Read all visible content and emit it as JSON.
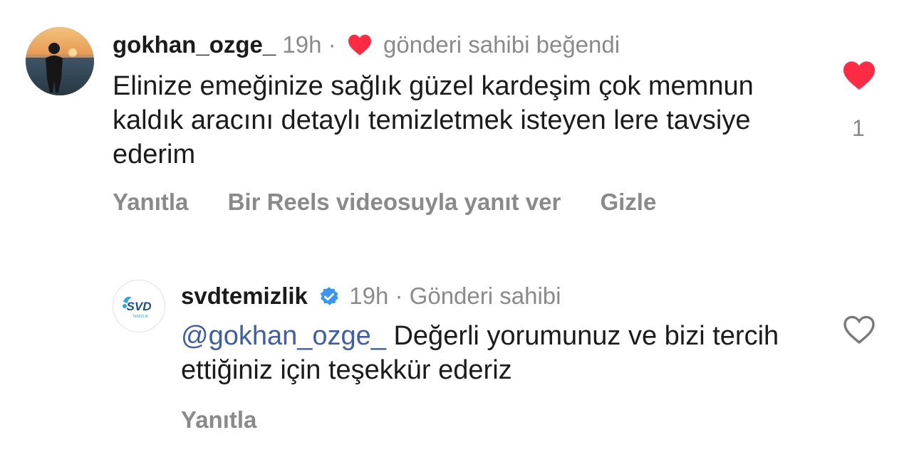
{
  "comment": {
    "username": "gokhan_ozge_",
    "time": "19h",
    "separator": "·",
    "liked_by_author_label": "gönderi sahibi beğendi",
    "text": "Elinize emeğinize sağlık güzel kardeşim çok memnun kaldık aracını detaylı temizletmek isteyen lere tavsiye ederim",
    "like_count": "1",
    "liked": true,
    "actions": {
      "reply": "Yanıtla",
      "reels_reply": "Bir Reels videosuyla yanıt ver",
      "hide": "Gizle"
    }
  },
  "reply": {
    "username": "svdtemizlik",
    "time": "19h",
    "separator": "·",
    "author_label": "Gönderi sahibi",
    "mention": "@gokhan_ozge_",
    "text": " Değerli yorumunuz ve bizi tercih ettiğiniz için teşekkür ederiz",
    "liked": false,
    "actions": {
      "reply": "Yanıtla"
    },
    "avatar_logo_text": "SVD",
    "avatar_logo_subtext": "TEMİZLİK"
  },
  "colors": {
    "heart_red": "#ff2a44",
    "verified_blue": "#3897f0",
    "mention_blue": "#3d5fa8",
    "meta_gray": "#8a8a8a"
  },
  "icons": {
    "liked_heart": "heart-filled-icon",
    "reply_heart": "heart-outline-icon",
    "verified": "verified-badge-icon"
  }
}
